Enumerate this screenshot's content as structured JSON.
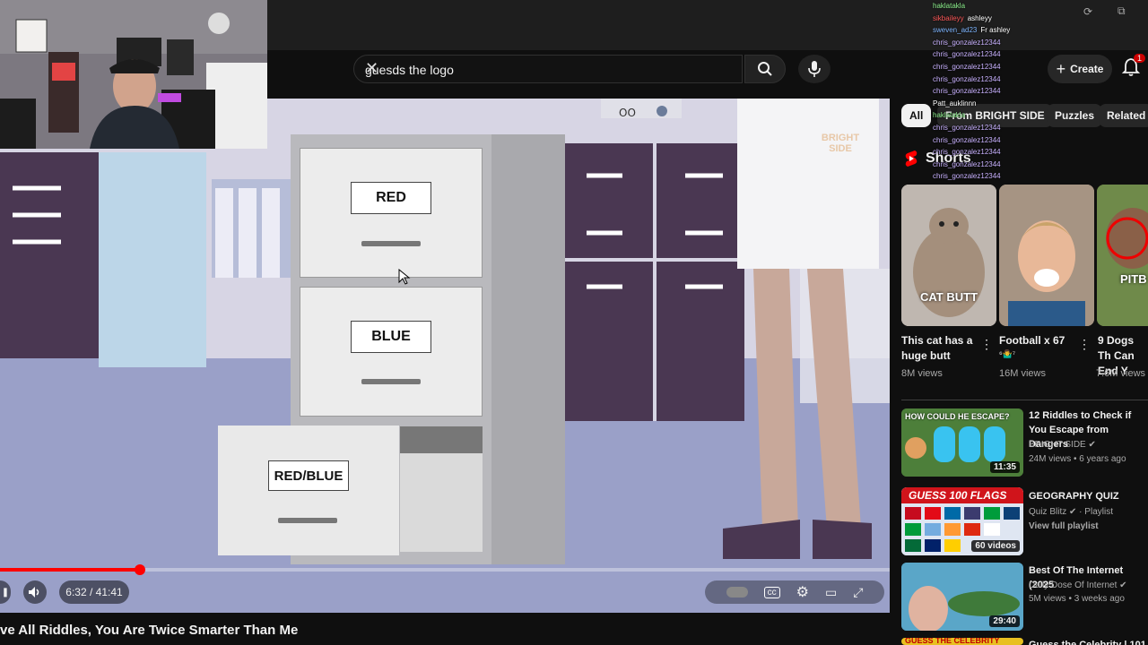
{
  "search": {
    "query": "guesds the logo"
  },
  "header": {
    "create_label": "Create",
    "notif_badge": "1"
  },
  "chat": {
    "lines": [
      {
        "user": "haklatakla",
        "text": "",
        "color": "#8ff28f"
      },
      {
        "user": "sikbaileyy",
        "text": "ashleyy",
        "color": "#ff5a5a"
      },
      {
        "user": "sweven_ad23",
        "text": "Fr ashley",
        "color": "#7fb6ff"
      },
      {
        "user": "chris_gonzalez12344",
        "text": "",
        "color": "#c9b2ff"
      },
      {
        "user": "chris_gonzalez12344",
        "text": "",
        "color": "#c9b2ff"
      },
      {
        "user": "chris_gonzalez12344",
        "text": "",
        "color": "#c9b2ff"
      },
      {
        "user": "chris_gonzalez12344",
        "text": "",
        "color": "#c9b2ff"
      },
      {
        "user": "chris_gonzalez12344",
        "text": "",
        "color": "#c9b2ff"
      },
      {
        "user": "Patt_auklinnn",
        "text": "",
        "color": "#ffffff"
      },
      {
        "user": "haklatakla",
        "text": "",
        "color": "#8ff28f"
      },
      {
        "user": "chris_gonzalez12344",
        "text": "",
        "color": "#c9b2ff"
      },
      {
        "user": "chris_gonzalez12344",
        "text": "",
        "color": "#c9b2ff"
      },
      {
        "user": "chris_gonzalez12344",
        "text": "",
        "color": "#c9b2ff"
      },
      {
        "user": "chris_gonzalez12344",
        "text": "",
        "color": "#c9b2ff"
      },
      {
        "user": "chris_gonzalez12344",
        "text": "",
        "color": "#c9b2ff"
      }
    ]
  },
  "video": {
    "title": "ve All Riddles, You Are Twice Smarter Than Me",
    "time": "6:32 / 41:41",
    "progress": 0.157,
    "labels": {
      "red": "RED",
      "blue": "BLUE",
      "redblue": "RED/BLUE"
    },
    "watermark": "BRIGHT SIDE"
  },
  "chips": [
    {
      "label": "All",
      "active": true
    },
    {
      "label": "From BRIGHT SIDE",
      "active": false
    },
    {
      "label": "Puzzles",
      "active": false
    },
    {
      "label": "Related",
      "active": false
    }
  ],
  "shorts": {
    "header": "Shorts",
    "items": [
      {
        "title": "This cat has a huge butt",
        "views": "8M views",
        "overlay": "CAT BUTT"
      },
      {
        "title": "Football x 67",
        "emoji": "⁶🤷‍♂️⁷",
        "views": "16M views"
      },
      {
        "title": "9 Dogs Th Can End Y",
        "views": "7.6M views",
        "overlay": "PITB"
      }
    ]
  },
  "videos": [
    {
      "title": "12 Riddles to Check if You Escape from Dangers",
      "channel": "BRIGHT SIDE",
      "meta": "24M views • 6 years ago",
      "duration": "11:35",
      "thumb_text": "HOW COULD HE ESCAPE?"
    },
    {
      "title": "GEOGRAPHY QUIZ",
      "channel": "Quiz Blitz",
      "meta": "Playlist",
      "extra": "View full playlist",
      "duration": "60 videos",
      "thumb_text": "GUESS 100 FLAGS"
    },
    {
      "title": "Best Of The Internet (2025",
      "channel": "Daily Dose Of Internet",
      "meta": "5M views • 3 weeks ago",
      "duration": "29:40"
    },
    {
      "title": "Guess the Celebrity | 101",
      "thumb_text": "GUESS THE CELEBRITY"
    }
  ],
  "colors": {
    "accent": "#ff0000",
    "bg": "#0f0f0f"
  }
}
